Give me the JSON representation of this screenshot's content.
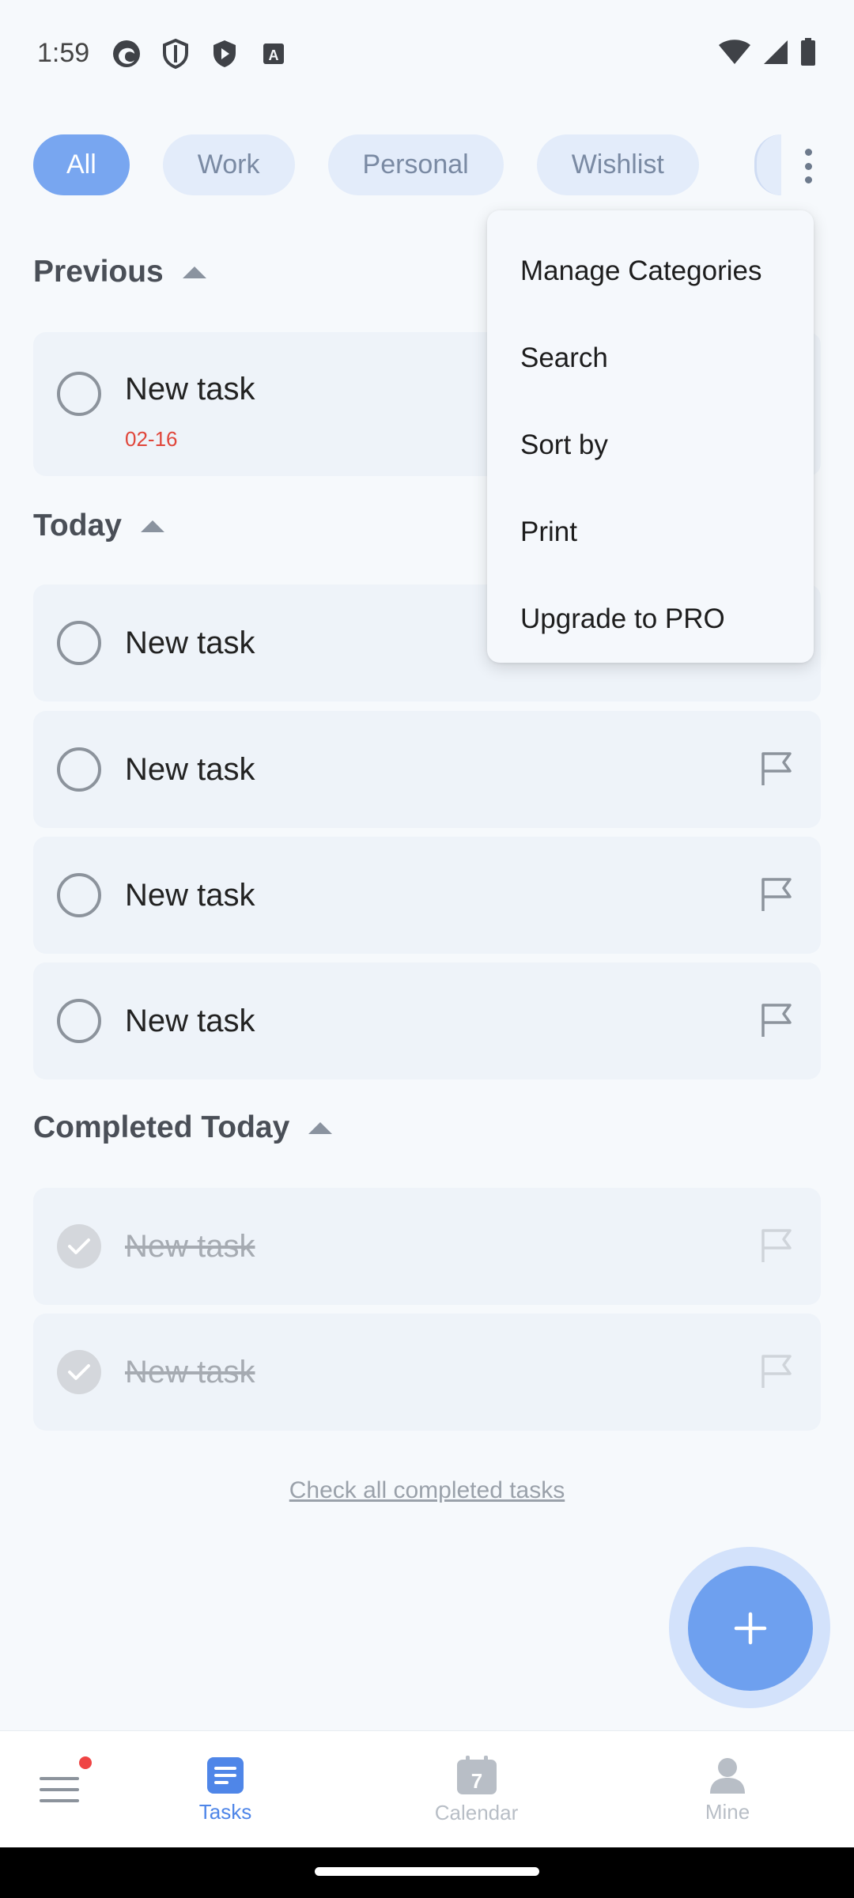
{
  "status_bar": {
    "time": "1:59",
    "icons": [
      "edge-icon",
      "shield-outline-icon",
      "shield-play-icon",
      "a-box-icon"
    ],
    "right_icons": [
      "wifi-icon",
      "signal-icon",
      "battery-icon"
    ]
  },
  "chips": [
    {
      "label": "All",
      "active": true
    },
    {
      "label": "Work",
      "active": false
    },
    {
      "label": "Personal",
      "active": false
    },
    {
      "label": "Wishlist",
      "active": false
    }
  ],
  "sections": {
    "previous": "Previous",
    "today": "Today",
    "completed": "Completed Today"
  },
  "tasks": {
    "previous": [
      {
        "title": "New task",
        "date": "02-16"
      }
    ],
    "today": [
      {
        "title": "New task"
      },
      {
        "title": "New task"
      },
      {
        "title": "New task"
      },
      {
        "title": "New task"
      }
    ],
    "completed": [
      {
        "title": "New task"
      },
      {
        "title": "New task"
      }
    ]
  },
  "check_all_label": "Check all completed tasks",
  "menu": {
    "items": [
      "Manage Categories",
      "Search",
      "Sort by",
      "Print",
      "Upgrade to PRO"
    ]
  },
  "bottom_nav": {
    "items": [
      {
        "label": "",
        "icon": "hamburger-icon"
      },
      {
        "label": "Tasks",
        "icon": "tasks-icon",
        "active": true
      },
      {
        "label": "Calendar",
        "icon": "calendar-icon",
        "day": "7"
      },
      {
        "label": "Mine",
        "icon": "person-icon"
      }
    ]
  },
  "colors": {
    "accent": "#78a6f0",
    "date_overdue": "#e0463b",
    "nav_active": "#4f86e8"
  }
}
